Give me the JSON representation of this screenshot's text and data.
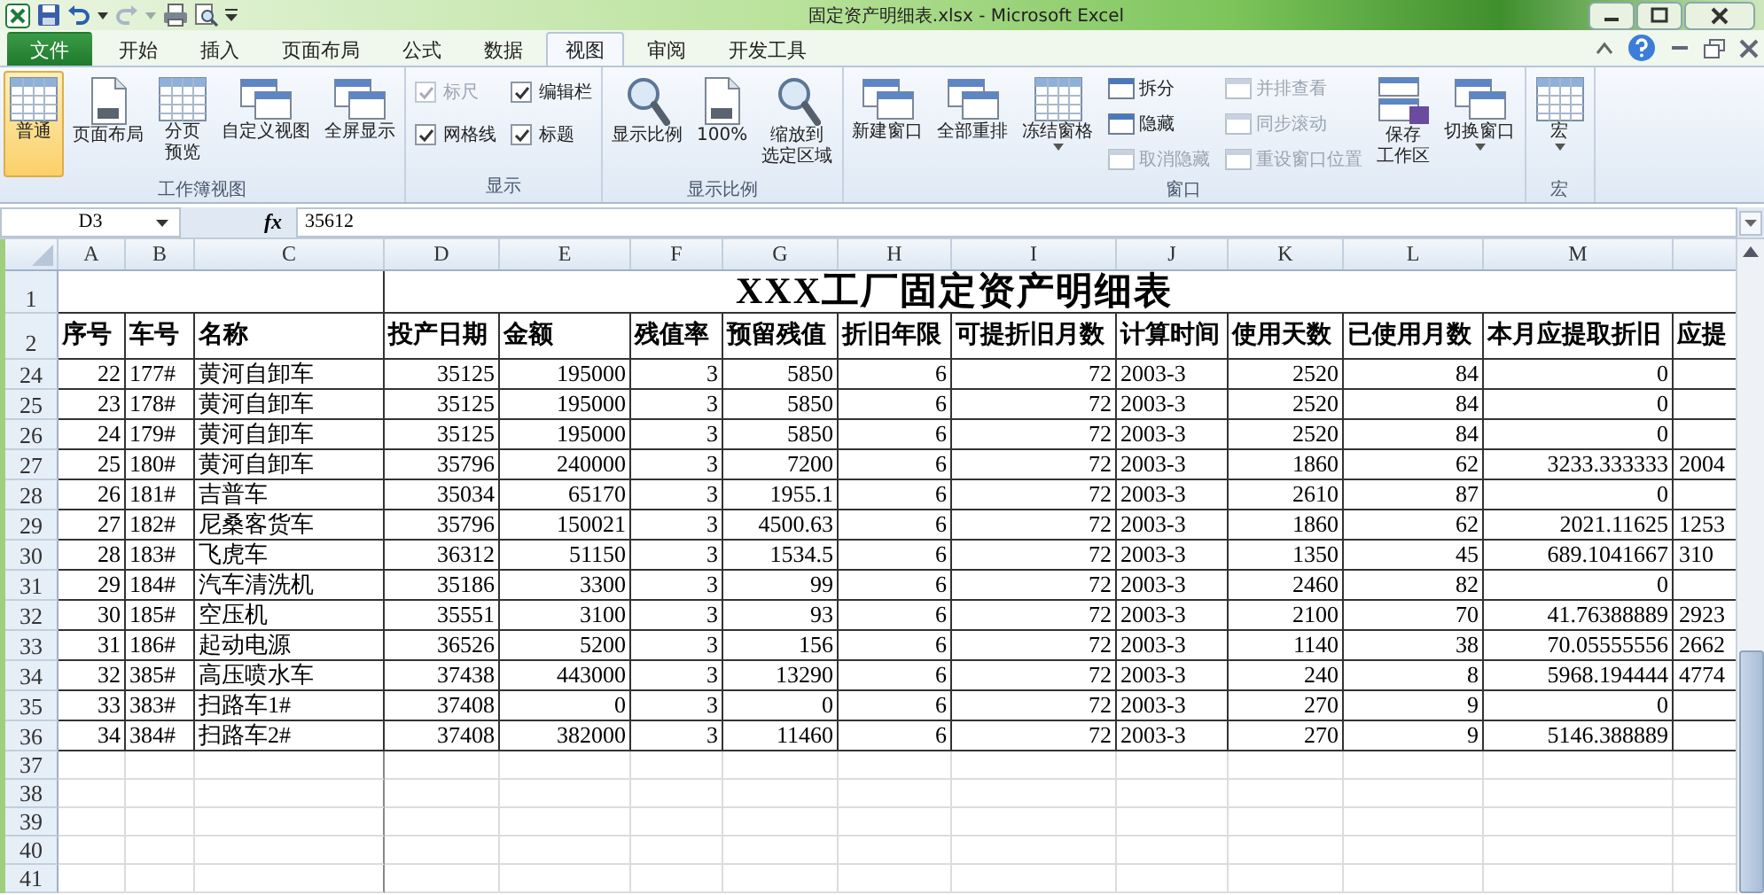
{
  "window": {
    "title": "固定资产明细表.xlsx - Microsoft Excel"
  },
  "ribbon_tabs": [
    {
      "label": "文件",
      "kind": "file",
      "selected": false
    },
    {
      "label": "开始",
      "kind": "tab",
      "selected": false
    },
    {
      "label": "插入",
      "kind": "tab",
      "selected": false
    },
    {
      "label": "页面布局",
      "kind": "tab",
      "selected": false
    },
    {
      "label": "公式",
      "kind": "tab",
      "selected": false
    },
    {
      "label": "数据",
      "kind": "tab",
      "selected": false
    },
    {
      "label": "视图",
      "kind": "tab",
      "selected": true
    },
    {
      "label": "审阅",
      "kind": "tab",
      "selected": false
    },
    {
      "label": "开发工具",
      "kind": "tab",
      "selected": false
    }
  ],
  "ribbon_groups": [
    {
      "label": "工作簿视图",
      "items": [
        {
          "kind": "large",
          "lines": [
            "普通"
          ],
          "selected": true
        },
        {
          "kind": "large",
          "lines": [
            "页面布局"
          ],
          "selected": false
        },
        {
          "kind": "large",
          "lines": [
            "分页",
            "预览"
          ],
          "selected": false
        },
        {
          "kind": "large",
          "lines": [
            "自定义视图"
          ],
          "selected": false
        },
        {
          "kind": "large",
          "lines": [
            "全屏显示"
          ],
          "selected": false
        }
      ]
    },
    {
      "label": "显示",
      "items": [
        {
          "kind": "stack",
          "items": [
            {
              "kind": "check",
              "label": "标尺",
              "checked": true,
              "disabled": true
            },
            {
              "kind": "check",
              "label": "网格线",
              "checked": true,
              "disabled": false
            }
          ]
        },
        {
          "kind": "stack",
          "items": [
            {
              "kind": "check",
              "label": "编辑栏",
              "checked": true,
              "disabled": false
            },
            {
              "kind": "check",
              "label": "标题",
              "checked": true,
              "disabled": false
            }
          ]
        }
      ]
    },
    {
      "label": "显示比例",
      "items": [
        {
          "kind": "large",
          "lines": [
            "显示比例"
          ]
        },
        {
          "kind": "large",
          "lines": [
            "100%"
          ]
        },
        {
          "kind": "large",
          "lines": [
            "缩放到",
            "选定区域"
          ]
        }
      ]
    },
    {
      "label": "窗口",
      "items": [
        {
          "kind": "large",
          "lines": [
            "新建窗口"
          ]
        },
        {
          "kind": "large",
          "lines": [
            "全部重排"
          ]
        },
        {
          "kind": "large",
          "lines": [
            "冻结窗格"
          ],
          "dropdown": true
        },
        {
          "kind": "stack",
          "items": [
            {
              "kind": "small",
              "label": "拆分",
              "disabled": false
            },
            {
              "kind": "small",
              "label": "隐藏",
              "disabled": false
            },
            {
              "kind": "small",
              "label": "取消隐藏",
              "disabled": true
            }
          ]
        },
        {
          "kind": "stack",
          "items": [
            {
              "kind": "small",
              "label": "并排查看",
              "disabled": true
            },
            {
              "kind": "small",
              "label": "同步滚动",
              "disabled": true
            },
            {
              "kind": "small",
              "label": "重设窗口位置",
              "disabled": true
            }
          ]
        },
        {
          "kind": "large",
          "lines": [
            "保存",
            "工作区"
          ]
        },
        {
          "kind": "large",
          "lines": [
            "切换窗口"
          ],
          "dropdown": true
        }
      ]
    },
    {
      "label": "宏",
      "items": [
        {
          "kind": "large",
          "lines": [
            "宏"
          ],
          "dropdown": true
        }
      ]
    }
  ],
  "formula_bar": {
    "name_box": "D3",
    "function_label": "fx",
    "value": "35612"
  },
  "sheet": {
    "columns": [
      "A",
      "B",
      "C",
      "D",
      "E",
      "F",
      "G",
      "H",
      "I",
      "J",
      "K",
      "L",
      "M"
    ],
    "title_row": {
      "number": "1",
      "title": "XXX工厂固定资产明细表"
    },
    "header_row": {
      "number": "2",
      "cells": [
        "序号",
        "车号",
        "名称",
        "投产日期",
        "金额",
        "残值率",
        "预留残值",
        "折旧年限",
        "可提折旧月数",
        "计算时间",
        "使用天数",
        "已使用月数",
        "本月应提取折旧",
        "应提"
      ]
    },
    "rows": [
      {
        "number": "24",
        "cells": [
          "22",
          "177#",
          "黄河自卸车",
          "35125",
          "195000",
          "3",
          "5850",
          "6",
          "72",
          "2003-3",
          "2520",
          "84",
          "0",
          null
        ]
      },
      {
        "number": "25",
        "cells": [
          "23",
          "178#",
          "黄河自卸车",
          "35125",
          "195000",
          "3",
          "5850",
          "6",
          "72",
          "2003-3",
          "2520",
          "84",
          "0",
          null
        ]
      },
      {
        "number": "26",
        "cells": [
          "24",
          "179#",
          "黄河自卸车",
          "35125",
          "195000",
          "3",
          "5850",
          "6",
          "72",
          "2003-3",
          "2520",
          "84",
          "0",
          null
        ]
      },
      {
        "number": "27",
        "cells": [
          "25",
          "180#",
          "黄河自卸车",
          "35796",
          "240000",
          "3",
          "7200",
          "6",
          "72",
          "2003-3",
          "1860",
          "62",
          "3233.333333",
          "2004"
        ]
      },
      {
        "number": "28",
        "cells": [
          "26",
          "181#",
          "吉普车",
          "35034",
          "65170",
          "3",
          "1955.1",
          "6",
          "72",
          "2003-3",
          "2610",
          "87",
          "0",
          null
        ]
      },
      {
        "number": "29",
        "cells": [
          "27",
          "182#",
          "尼桑客货车",
          "35796",
          "150021",
          "3",
          "4500.63",
          "6",
          "72",
          "2003-3",
          "1860",
          "62",
          "2021.11625",
          "1253"
        ]
      },
      {
        "number": "30",
        "cells": [
          "28",
          "183#",
          "飞虎车",
          "36312",
          "51150",
          "3",
          "1534.5",
          "6",
          "72",
          "2003-3",
          "1350",
          "45",
          "689.1041667",
          "310"
        ]
      },
      {
        "number": "31",
        "cells": [
          "29",
          "184#",
          "汽车清洗机",
          "35186",
          "3300",
          "3",
          "99",
          "6",
          "72",
          "2003-3",
          "2460",
          "82",
          "0",
          null
        ]
      },
      {
        "number": "32",
        "cells": [
          "30",
          "185#",
          "空压机",
          "35551",
          "3100",
          "3",
          "93",
          "6",
          "72",
          "2003-3",
          "2100",
          "70",
          "41.76388889",
          "2923"
        ]
      },
      {
        "number": "33",
        "cells": [
          "31",
          "186#",
          "起动电源",
          "36526",
          "5200",
          "3",
          "156",
          "6",
          "72",
          "2003-3",
          "1140",
          "38",
          "70.05555556",
          "2662"
        ]
      },
      {
        "number": "34",
        "cells": [
          "32",
          "385#",
          "高压喷水车",
          "37438",
          "443000",
          "3",
          "13290",
          "6",
          "72",
          "2003-3",
          "240",
          "8",
          "5968.194444",
          "4774"
        ]
      },
      {
        "number": "35",
        "cells": [
          "33",
          "383#",
          "扫路车1#",
          "37408",
          "0",
          "3",
          "0",
          "6",
          "72",
          "2003-3",
          "270",
          "9",
          "0",
          null
        ]
      },
      {
        "number": "36",
        "cells": [
          "34",
          "384#",
          "扫路车2#",
          "37408",
          "382000",
          "3",
          "11460",
          "6",
          "72",
          "2003-3",
          "270",
          "9",
          "5146.388889",
          null
        ]
      }
    ],
    "empty_rows": [
      "37",
      "38",
      "39",
      "40",
      "41"
    ]
  }
}
